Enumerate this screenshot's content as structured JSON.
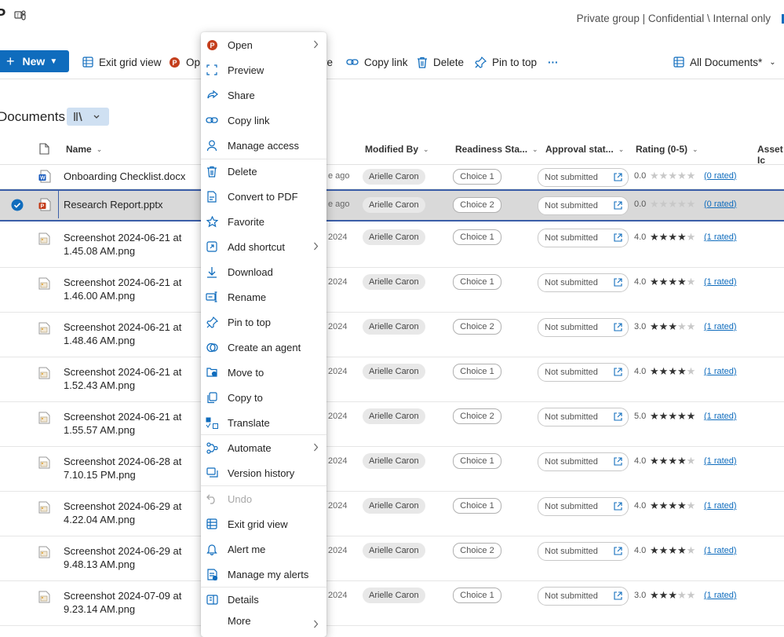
{
  "header": {
    "logo_letter": "P",
    "group_info": "Private group | Confidential \\ Internal only"
  },
  "toolbar": {
    "new_label": "New",
    "exit_grid_label": "Exit grid view",
    "open_label": "Op",
    "share_partial": "re",
    "copy_link_label": "Copy link",
    "delete_label": "Delete",
    "pin_label": "Pin to top",
    "more_label": "···",
    "view_label": "All Documents*"
  },
  "library": {
    "title": "Documents"
  },
  "columns": {
    "name": "Name",
    "modified_by": "Modified By",
    "readiness": "Readiness Sta...",
    "approval": "Approval stat...",
    "rating": "Rating (0-5)",
    "asset": "Asset Ic"
  },
  "rows": [
    {
      "name": "Onboarding Checklist.docx",
      "date": "e ago",
      "modified_by": "Arielle Caron",
      "readiness": "Choice 1",
      "approval": "Not submitted",
      "rating_text": "0.0",
      "rating": 0,
      "rated": "(0 rated)",
      "type": "word"
    },
    {
      "name": "Research Report.pptx",
      "date": "e ago",
      "modified_by": "Arielle Caron",
      "readiness": "Choice 2",
      "approval": "Not submitted",
      "rating_text": "0.0",
      "rating": 0,
      "rated": "(0 rated)",
      "type": "ppt",
      "selected": true
    },
    {
      "name1": "Screenshot 2024-06-21 at",
      "name2": "1.45.08 AM.png",
      "date": "2024",
      "modified_by": "Arielle Caron",
      "readiness": "Choice 1",
      "approval": "Not submitted",
      "rating_text": "4.0",
      "rating": 4,
      "rated": "(1 rated)",
      "type": "img"
    },
    {
      "name1": "Screenshot 2024-06-21 at",
      "name2": "1.46.00 AM.png",
      "date": "2024",
      "modified_by": "Arielle Caron",
      "readiness": "Choice 1",
      "approval": "Not submitted",
      "rating_text": "4.0",
      "rating": 4,
      "rated": "(1 rated)",
      "type": "img"
    },
    {
      "name1": "Screenshot 2024-06-21 at",
      "name2": "1.48.46 AM.png",
      "date": "2024",
      "modified_by": "Arielle Caron",
      "readiness": "Choice 2",
      "approval": "Not submitted",
      "rating_text": "3.0",
      "rating": 3,
      "rated": "(1 rated)",
      "type": "img"
    },
    {
      "name1": "Screenshot 2024-06-21 at",
      "name2": "1.52.43 AM.png",
      "date": "2024",
      "modified_by": "Arielle Caron",
      "readiness": "Choice 1",
      "approval": "Not submitted",
      "rating_text": "4.0",
      "rating": 4,
      "rated": "(1 rated)",
      "type": "img"
    },
    {
      "name1": "Screenshot 2024-06-21 at",
      "name2": "1.55.57 AM.png",
      "date": "2024",
      "modified_by": "Arielle Caron",
      "readiness": "Choice 2",
      "approval": "Not submitted",
      "rating_text": "5.0",
      "rating": 5,
      "rated": "(1 rated)",
      "type": "img"
    },
    {
      "name1": "Screenshot 2024-06-28 at",
      "name2": "7.10.15 PM.png",
      "date": "2024",
      "modified_by": "Arielle Caron",
      "readiness": "Choice 1",
      "approval": "Not submitted",
      "rating_text": "4.0",
      "rating": 4,
      "rated": "(1 rated)",
      "type": "img"
    },
    {
      "name1": "Screenshot 2024-06-29 at",
      "name2": "4.22.04 AM.png",
      "date": "2024",
      "modified_by": "Arielle Caron",
      "readiness": "Choice 1",
      "approval": "Not submitted",
      "rating_text": "4.0",
      "rating": 4,
      "rated": "(1 rated)",
      "type": "img"
    },
    {
      "name1": "Screenshot 2024-06-29 at",
      "name2": "9.48.13 AM.png",
      "date": "2024",
      "modified_by": "Arielle Caron",
      "readiness": "Choice 2",
      "approval": "Not submitted",
      "rating_text": "4.0",
      "rating": 4,
      "rated": "(1 rated)",
      "type": "img"
    },
    {
      "name1": "Screenshot 2024-07-09 at",
      "name2": "9.23.14 AM.png",
      "date": "2024",
      "modified_by": "Arielle Caron",
      "readiness": "Choice 1",
      "approval": "Not submitted",
      "rating_text": "3.0",
      "rating": 3,
      "rated": "(1 rated)",
      "type": "img"
    }
  ],
  "context_menu": {
    "open": "Open",
    "preview": "Preview",
    "share": "Share",
    "copy_link": "Copy link",
    "manage_access": "Manage access",
    "delete": "Delete",
    "convert_pdf": "Convert to PDF",
    "favorite": "Favorite",
    "add_shortcut": "Add shortcut",
    "download": "Download",
    "rename": "Rename",
    "pin_to_top": "Pin to top",
    "create_agent": "Create an agent",
    "move_to": "Move to",
    "copy_to": "Copy to",
    "translate": "Translate",
    "automate": "Automate",
    "version_history": "Version history",
    "undo": "Undo",
    "exit_grid": "Exit grid view",
    "alert_me": "Alert me",
    "manage_alerts": "Manage my alerts",
    "details": "Details",
    "more": "More"
  },
  "colors": {
    "accent": "#0f6cbd",
    "selection": "#d9d9d9",
    "ppt": "#c43e1c",
    "word": "#185abd"
  }
}
